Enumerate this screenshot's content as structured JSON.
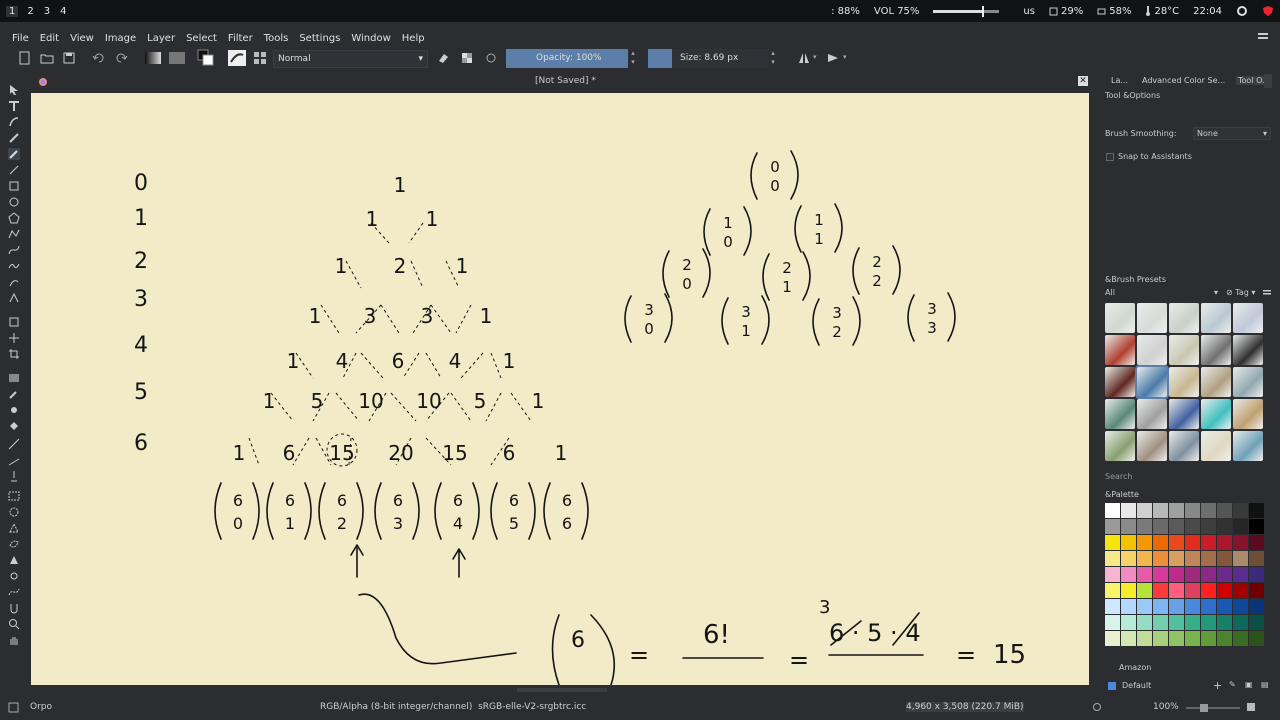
{
  "topbar": {
    "workspaces": [
      "1",
      "2",
      "3",
      "4"
    ],
    "brightness": ": 88%",
    "volume_label": "VOL 75%",
    "volume_level": 0.75,
    "keyboard": "us",
    "cpu": "29%",
    "mem": "58%",
    "temp": "28°C",
    "clock": "22:04"
  },
  "menu": [
    "File",
    "Edit",
    "View",
    "Image",
    "Layer",
    "Select",
    "Filter",
    "Tools",
    "Settings",
    "Window",
    "Help"
  ],
  "toolbar": {
    "blend_mode": "Normal",
    "opacity_label": "Opacity: 100%",
    "opacity_level": 1.0,
    "size_label": "Size: 8.69 px"
  },
  "document": {
    "title": "[Not Saved]",
    "modified_marker": "*"
  },
  "drawing": {
    "row_numbers": [
      "0",
      "1",
      "2",
      "3",
      "4",
      "5",
      "6"
    ],
    "triangle_rows": [
      [
        "1"
      ],
      [
        "1",
        "1"
      ],
      [
        "1",
        "2",
        "1"
      ],
      [
        "1",
        "3",
        "3",
        "1"
      ],
      [
        "1",
        "4",
        "6",
        "4",
        "1"
      ],
      [
        "1",
        "5",
        "10",
        "10",
        "5",
        "1"
      ],
      [
        "1",
        "6",
        "15",
        "20",
        "15",
        "6",
        "1"
      ]
    ],
    "binomial_row": [
      [
        "6",
        "0"
      ],
      [
        "6",
        "1"
      ],
      [
        "6",
        "2"
      ],
      [
        "6",
        "3"
      ],
      [
        "6",
        "4"
      ],
      [
        "6",
        "5"
      ],
      [
        "6",
        "6"
      ]
    ],
    "right_triangle": [
      [
        [
          "0",
          "0"
        ]
      ],
      [
        [
          "1",
          "0"
        ],
        [
          "1",
          "1"
        ]
      ],
      [
        [
          "2",
          "0"
        ],
        [
          "2",
          "1"
        ],
        [
          "2",
          "2"
        ]
      ],
      [
        [
          "3",
          "0"
        ],
        [
          "3",
          "1"
        ],
        [
          "3",
          "2"
        ],
        [
          "3",
          "3"
        ]
      ]
    ],
    "formula": {
      "binom_top": "6",
      "eq1": "=",
      "frac1_num": "6!",
      "eq2": "=",
      "superscript": "3",
      "frac2_num": "6 · 5 · 4",
      "eq3": "=",
      "result": "15"
    }
  },
  "docker": {
    "tabs": [
      "La...",
      "Advanced Color Se...",
      "Tool O..."
    ],
    "tool_options_title": "Tool &Options",
    "brush_smoothing_label": "Brush Smoothing:",
    "brush_smoothing_value": "None",
    "snap_label": "Snap to Assistants",
    "presets_title": "&Brush Presets",
    "presets_filter": "All",
    "presets_tag": "Tag",
    "presets_search": "Search",
    "palette_title": "&Palette",
    "palette_name": "Amazon",
    "palette_default": "Default"
  },
  "statusbar": {
    "tool": "Orpo",
    "color_info": "RGB/Alpha (8-bit integer/channel)  sRGB-elle-V2-srgbtrc.icc",
    "dimensions": "4,960 x 3,508 (220.7 MiB)",
    "zoom": "100%"
  },
  "colors": {
    "canvas_bg": "#f2ebc8",
    "accent": "#5b7fa8",
    "chrome": "#2b2d30",
    "palette": [
      "#ffffff",
      "#e8e8e8",
      "#d0d0d0",
      "#b8b8b8",
      "#a0a0a0",
      "#888888",
      "#6e6e6e",
      "#555555",
      "#3a3a3a",
      "#111111",
      "#9a9a9a",
      "#8a8a8a",
      "#7a7a7a",
      "#6a6a6a",
      "#5a5a5a",
      "#4a4a4a",
      "#3e3e3e",
      "#323232",
      "#262626",
      "#000000",
      "#f5e50c",
      "#f2c400",
      "#f39a00",
      "#ec6a00",
      "#e84a1c",
      "#e02c1e",
      "#c81e2a",
      "#a8182e",
      "#86122c",
      "#5a0c1e",
      "#f7e98a",
      "#f5d36a",
      "#f2b64c",
      "#ec8e3c",
      "#d7a060",
      "#c0865a",
      "#a26e4c",
      "#84563c",
      "#a88a6c",
      "#6e4e36",
      "#f6b6d2",
      "#f08cc0",
      "#e85aa8",
      "#d83a9a",
      "#c02a8c",
      "#a0287e",
      "#8a2a86",
      "#6e2a8a",
      "#5a2c8c",
      "#3a2a7a",
      "#f8f36a",
      "#f4ee2a",
      "#b7e23c",
      "#ff3a3a",
      "#ff5e7e",
      "#e04060",
      "#ff2020",
      "#d00000",
      "#a00000",
      "#700000",
      "#cfe8ff",
      "#b4d8ff",
      "#9cc8f8",
      "#80b4f0",
      "#6aa0e8",
      "#4a88dc",
      "#2e6ecc",
      "#1a58b4",
      "#12469a",
      "#0a3478",
      "#d8f4ea",
      "#b8ead8",
      "#96dcc4",
      "#74ceb0",
      "#52c09c",
      "#36ae88",
      "#24987a",
      "#18806a",
      "#10685a",
      "#0a5048",
      "#e8f0d0",
      "#d4e8b4",
      "#c0dc98",
      "#a8d07c",
      "#90c464",
      "#78b44c",
      "#609c3c",
      "#4c842e",
      "#3a6c24",
      "#2a541a"
    ]
  }
}
